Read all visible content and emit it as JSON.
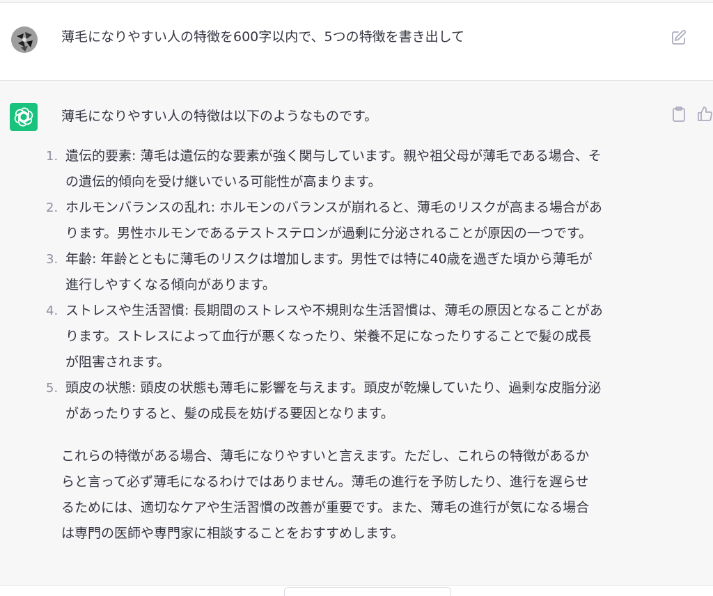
{
  "conversation": {
    "user_message": "薄毛になりやすい人の特徴を600字以内で、5つの特徴を書き出して",
    "assistant": {
      "intro": "薄毛になりやすい人の特徴は以下のようなものです。",
      "items": [
        {
          "number": "1.",
          "line1": "遺伝的要素: 薄毛は遺伝的な要素が強く関与しています。親や祖父母が薄毛である場合、そ",
          "line2": "の遺伝的傾向を受け継いでいる可能性が高まります。",
          "line3": ""
        },
        {
          "number": "2.",
          "line1": "ホルモンバランスの乱れ: ホルモンのバランスが崩れると、薄毛のリスクが高まる場合があ",
          "line2": "ります。男性ホルモンであるテストステロンが過剰に分泌されることが原因の一つです。",
          "line3": ""
        },
        {
          "number": "3.",
          "line1": "年齢: 年齢とともに薄毛のリスクは増加します。男性では特に40歳を過ぎた頃から薄毛が",
          "line2": "進行しやすくなる傾向があります。",
          "line3": ""
        },
        {
          "number": "4.",
          "line1": "ストレスや生活習慣: 長期間のストレスや不規則な生活習慣は、薄毛の原因となることがあ",
          "line2": "ります。ストレスによって血行が悪くなったり、栄養不足になったりすることで髪の成長",
          "line3": "が阻害されます。"
        },
        {
          "number": "5.",
          "line1": "頭皮の状態: 頭皮の状態も薄毛に影響を与えます。頭皮が乾燥していたり、過剰な皮脂分泌",
          "line2": "があったりすると、髪の成長を妨げる要因となります。",
          "line3": ""
        }
      ],
      "conclusion": {
        "line1": "これらの特徴がある場合、薄毛になりやすいと言えます。ただし、これらの特徴があるか",
        "line2": "らと言って必ず薄毛になるわけではありません。薄毛の進行を予防したり、進行を遅らせ",
        "line3": "るためには、適切なケアや生活習慣の改善が重要です。また、薄毛の進行が気になる場合",
        "line4": "は専門の医師や専門家に相談することをおすすめします。"
      }
    }
  },
  "icons": {
    "user_avatar": "user-avatar",
    "assistant_avatar": "openai-logo-icon",
    "edit": "edit-icon",
    "copy": "clipboard-icon",
    "like": "thumbs-up-icon"
  },
  "colors": {
    "assistant_background": "#f7f7f8",
    "assistant_avatar": "#19c37d",
    "text": "#343541",
    "muted_icon": "#acacbe"
  }
}
